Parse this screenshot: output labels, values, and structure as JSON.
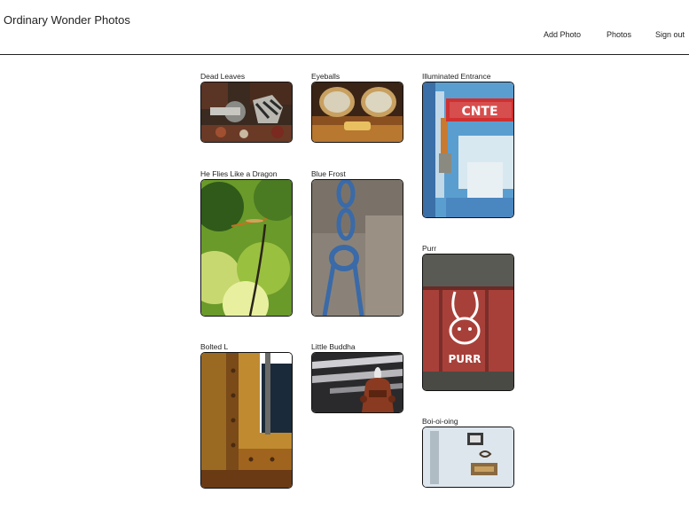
{
  "header": {
    "site_title": "Ordinary Wonder Photos",
    "nav": {
      "add_photo": "Add Photo",
      "photos": "Photos",
      "sign_out": "Sign out"
    }
  },
  "photos": [
    {
      "title": "Dead Leaves"
    },
    {
      "title": "Eyeballs"
    },
    {
      "title": "Illuminated Entrance"
    },
    {
      "title": "He Flies Like a Dragon"
    },
    {
      "title": "Blue Frost"
    },
    {
      "title": "Purr"
    },
    {
      "title": "Bolted L"
    },
    {
      "title": "Little Buddha"
    },
    {
      "title": "Boi-oi-oing"
    }
  ],
  "image_text": {
    "sign": "CNTE",
    "graffiti": "PURR"
  },
  "colors": {
    "border": "#111111",
    "text": "#222222",
    "background": "#ffffff"
  }
}
